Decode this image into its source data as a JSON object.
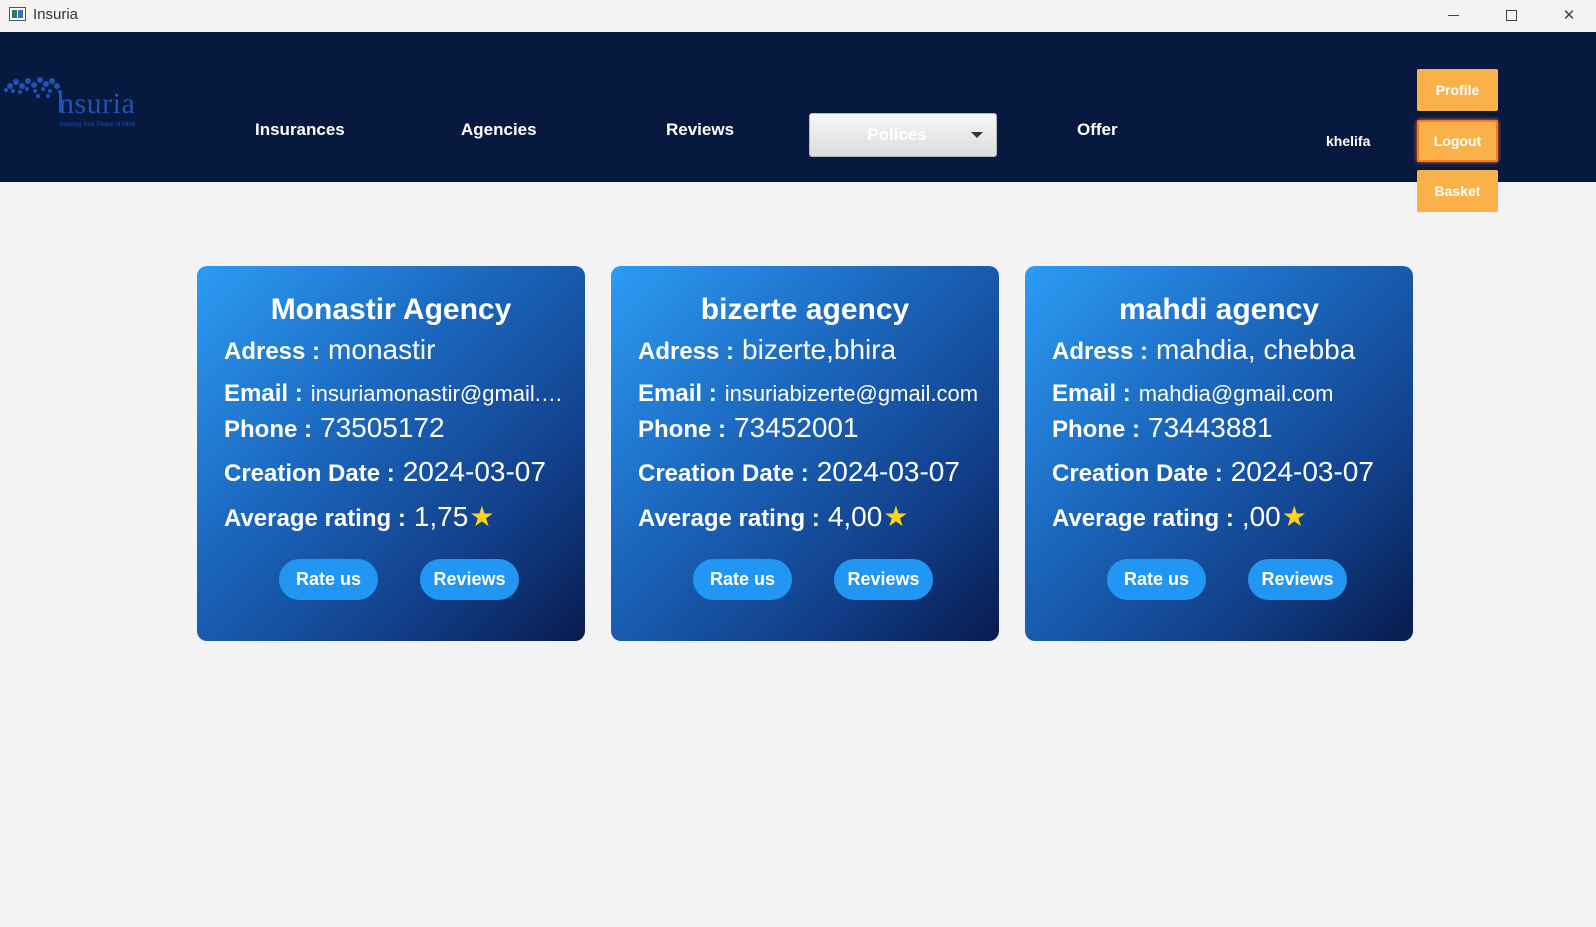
{
  "window": {
    "title": "Insuria"
  },
  "logo": {
    "text": "nsuria",
    "tagline": "Insuring Your Peace of Mind"
  },
  "nav": {
    "insurances": "Insurances",
    "agencies": "Agencies",
    "reviews": "Reviews",
    "polices": "Polices",
    "offer": "Offer"
  },
  "user": {
    "name": "khelifa"
  },
  "header_buttons": {
    "profile": "Profile",
    "logout": "Logout",
    "basket": "Basket"
  },
  "labels": {
    "adress": "Adress :",
    "email": "Email :",
    "phone": "Phone :",
    "creation_date": "Creation Date :",
    "average_rating": "Average rating :",
    "rate_us": "Rate us",
    "reviews": "Reviews"
  },
  "agencies": [
    {
      "name": "Monastir Agency",
      "adress": "monastir",
      "email": "insuriamonastir@gmail.c...",
      "phone": "73505172",
      "creation_date": "2024-03-07",
      "rating": "1,75"
    },
    {
      "name": "bizerte agency",
      "adress": "bizerte,bhira",
      "email": "insuriabizerte@gmail.com",
      "phone": "73452001",
      "creation_date": "2024-03-07",
      "rating": "4,00"
    },
    {
      "name": "mahdi agency",
      "adress": "mahdia, chebba",
      "email": "mahdia@gmail.com",
      "phone": "73443881",
      "creation_date": "2024-03-07",
      "rating": ",00"
    }
  ],
  "icons": {
    "rating": "star-icon",
    "star_color": "#ffd21f"
  },
  "colors": {
    "header_bg": "#08193f",
    "accent_orange": "#fbb14a",
    "card_button": "#2196f3"
  }
}
